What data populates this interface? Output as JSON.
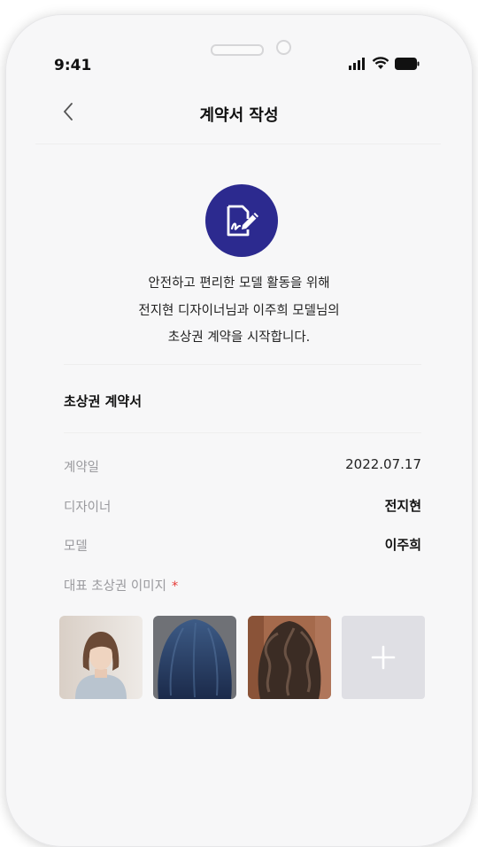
{
  "status": {
    "time": "9:41"
  },
  "header": {
    "title": "계약서 작성"
  },
  "intro": {
    "line1": "안전하고 편리한 모델 활동을 위해",
    "line2": "전지현 디자이너님과 이주희 모델님의",
    "line3": "초상권 계약을 시작합니다."
  },
  "contract": {
    "section_title": "초상권 계약서",
    "rows": [
      {
        "label": "계약일",
        "value": "2022.07.17"
      },
      {
        "label": "디자이너",
        "value": "전지현"
      },
      {
        "label": "모델",
        "value": "이주희"
      }
    ],
    "images_label": "대표 초상권 이미지",
    "required_mark": "*",
    "add_symbol": "+"
  },
  "colors": {
    "accent": "#2c2a8f",
    "required": "#e53935",
    "add_tile": "#dfdfe4"
  },
  "icons": [
    "back-chevron-icon",
    "signal-icon",
    "wifi-icon",
    "battery-icon",
    "contract-sign-icon",
    "plus-icon"
  ]
}
